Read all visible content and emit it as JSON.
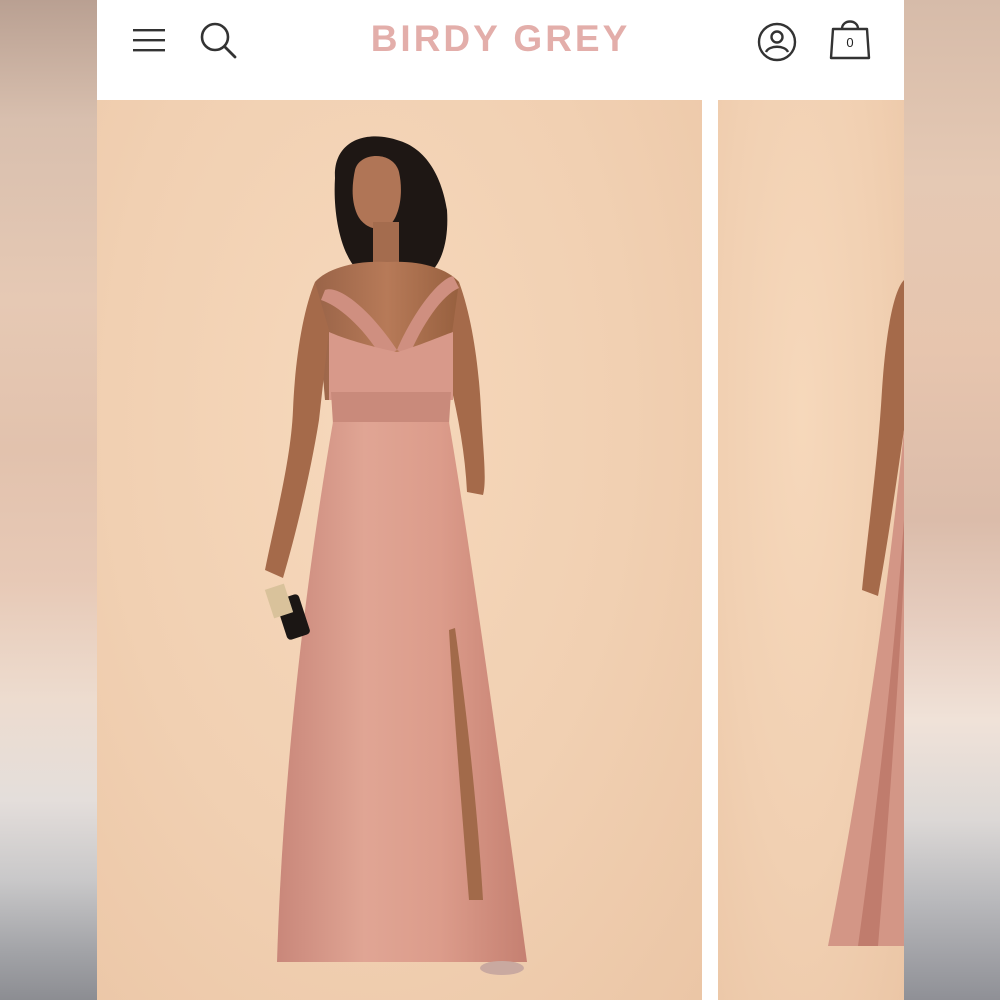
{
  "header": {
    "brand": "BIRDY GREY",
    "cart_count": "0",
    "icons": [
      "menu-icon",
      "search-icon",
      "account-icon",
      "bag-icon"
    ]
  },
  "colors": {
    "brand": "#e3aeaa",
    "backdrop": "#f1d0b2",
    "dress": "#d9998a"
  },
  "gallery": {
    "slides": [
      "product-photo-front",
      "product-photo-side"
    ]
  }
}
